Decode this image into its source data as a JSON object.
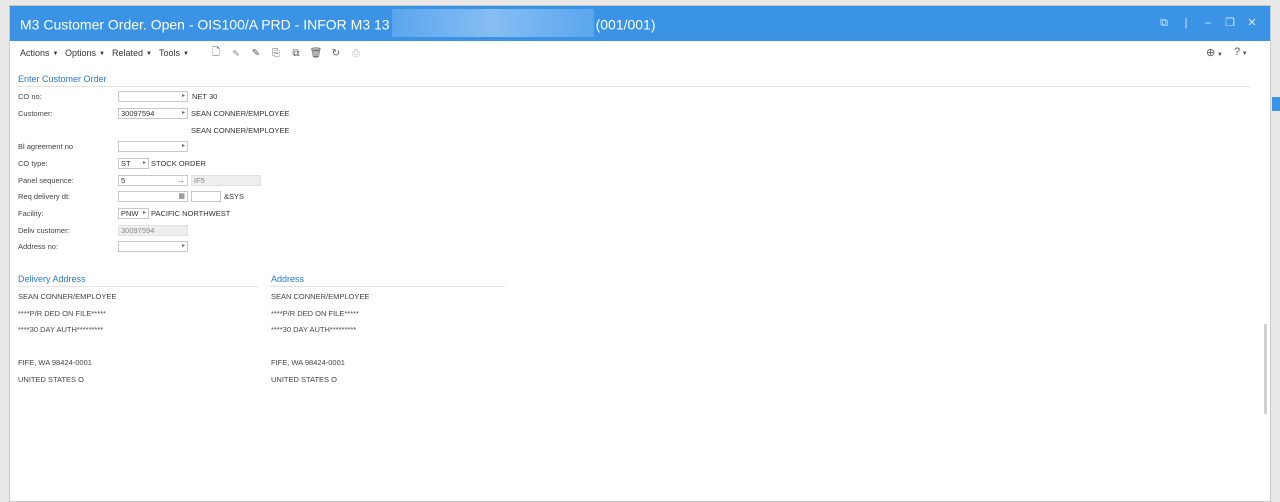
{
  "window": {
    "title_prefix": "M3 Customer Order. Open - OIS100/A   PRD - INFOR M3 13",
    "title_suffix": "(001/001)"
  },
  "toolbar": {
    "menus": [
      "Actions",
      "Options",
      "Related",
      "Tools"
    ],
    "icons": [
      "new-icon",
      "select-icon",
      "edit-icon",
      "copy-icon",
      "copy-alt-icon",
      "delete-icon",
      "refresh-icon",
      "print-icon"
    ]
  },
  "form": {
    "title": "Enter Customer Order",
    "co_no_label": "CO no:",
    "co_no_value": "",
    "co_no_desc": "NET 30",
    "customer_label": "Customer:",
    "customer_value": "30097594",
    "customer_desc1": "SEAN CONNER/EMPLOYEE",
    "customer_desc2": "SEAN CONNER/EMPLOYEE",
    "bl_label": "Bl agreement no",
    "co_type_label": "CO type:",
    "co_type_value": "ST",
    "co_type_desc": "STOCK ORDER",
    "panel_label": "Panel sequence:",
    "panel_value": "5",
    "panel_desc": "IF5",
    "req_label": "Req delivery dt:",
    "req_desc": "&SYS",
    "facility_label": "Facility:",
    "facility_value": "PNW",
    "facility_desc": "PACIFIC NORTHWEST",
    "deliv_label": "Deliv customer:",
    "deliv_value": "30097594",
    "address_no_label": "Address no:"
  },
  "delivery_address": {
    "title": "Delivery Address",
    "lines": [
      "SEAN CONNER/EMPLOYEE",
      "****P/R DED ON FILE*****",
      "****30 DAY AUTH*********",
      "",
      "FIFE, WA 98424-0001",
      "UNITED STATES O"
    ]
  },
  "address": {
    "title": "Address",
    "lines": [
      "SEAN CONNER/EMPLOYEE",
      "****P/R DED ON FILE*****",
      "****30 DAY AUTH*********",
      "",
      "FIFE, WA 98424-0001",
      "UNITED STATES O"
    ]
  }
}
